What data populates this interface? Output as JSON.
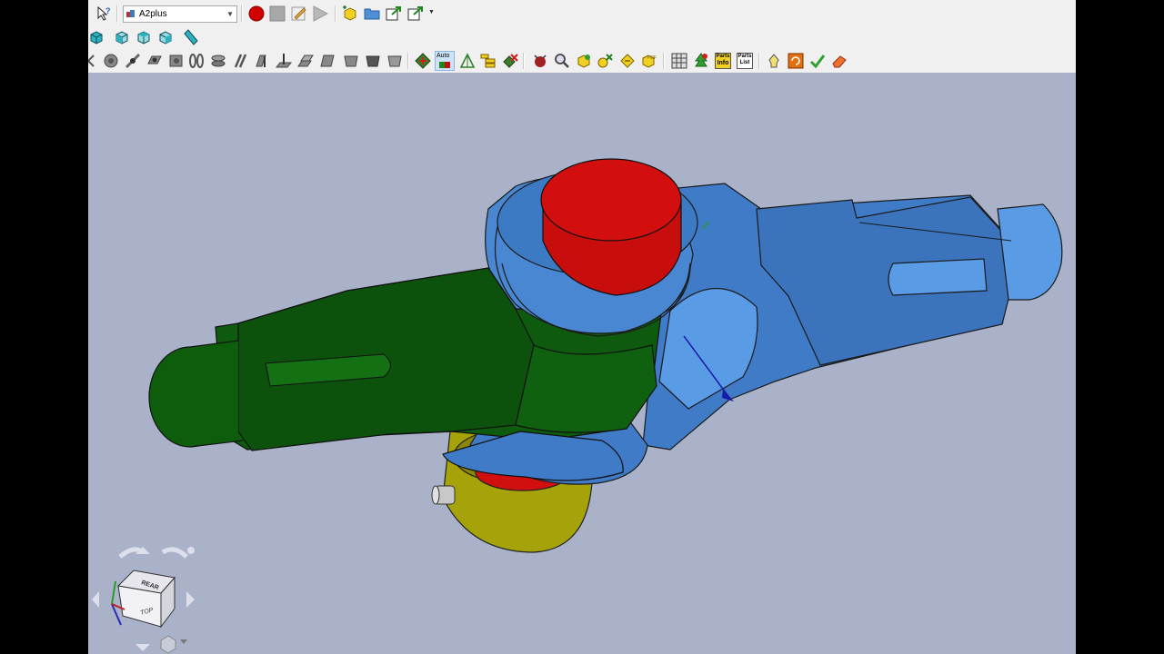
{
  "toolbar": {
    "workbench_selector": {
      "value": "A2plus",
      "icon": "a2plus-workbench-icon"
    },
    "auto_label": "Auto",
    "parts_info_label_top": "Parts",
    "parts_info_label_bottom": "Info",
    "parts_list_label_top": "Parts",
    "parts_list_label_bottom": "List",
    "tools": [
      "whats-this-icon",
      "record-macro-icon",
      "stop-macro-icon",
      "edit-macro-icon",
      "run-macro-icon",
      "add-part-icon",
      "open-folder-icon",
      "export-icon",
      "share-icon"
    ]
  },
  "navcube": {
    "front_label": "REAR",
    "top_label": "TOP"
  },
  "colors": {
    "background": "#a9b2c9",
    "green_part": "#0d5b0d",
    "blue_part": "#3d79c4",
    "red_pin": "#d80f0f",
    "yellow_collar": "#a3a00a"
  }
}
